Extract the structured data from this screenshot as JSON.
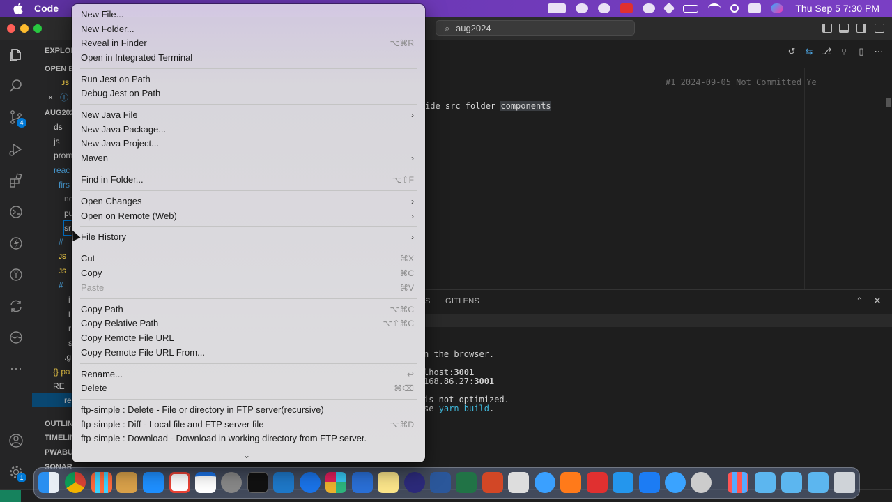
{
  "menubar": {
    "app_name": "Code",
    "clock": "Thu Sep 5  7:30 PM"
  },
  "titlebar": {
    "search_text": "aug2024"
  },
  "activity": {
    "scm_badge": "4",
    "account_badge": "1"
  },
  "sidebar": {
    "header": "EXPLORER",
    "open_editors": "OPEN E",
    "workspace": "AUG202",
    "items": [
      "ds",
      "js",
      "prom",
      "reac",
      "firs",
      "nc",
      "pu",
      "sr",
      "#",
      "JS",
      "JS",
      "#",
      "i",
      "l",
      "r",
      "s",
      ".g",
      "{} pa",
      "RE",
      "re"
    ],
    "outline": "OUTLIN",
    "timeline": "TIMELIN",
    "pwabu": "PWABU",
    "sonarlint": "SONARLINT ISSUE LOCATIONS"
  },
  "editor": {
    "blame": "#1 2024-09-05 Not Committed Ye",
    "code_prefix": "ide src folder ",
    "code_highlight": "components"
  },
  "panel": {
    "tab_partial": "S",
    "tab_gitlens": "GITLENS",
    "line1": "n the browser.",
    "line2_prefix": "lhost:",
    "line2_port": "3001",
    "line3_prefix": "168.86.27:",
    "line3_port": "3001",
    "line4": " is not optimized.",
    "line5_prefix": "se ",
    "line5_cmd": "yarn build",
    "line5_suffix": "."
  },
  "context_menu": {
    "items": [
      {
        "label": "New File...",
        "shortcut": ""
      },
      {
        "label": "New Folder...",
        "shortcut": ""
      },
      {
        "label": "Reveal in Finder",
        "shortcut": "⌥⌘R"
      },
      {
        "label": "Open in Integrated Terminal",
        "shortcut": ""
      },
      {
        "label": "Run Jest on Path",
        "shortcut": ""
      },
      {
        "label": "Debug Jest on Path",
        "shortcut": ""
      },
      {
        "label": "New Java File",
        "shortcut": ""
      },
      {
        "label": "New Java Package...",
        "shortcut": ""
      },
      {
        "label": "New Java Project...",
        "shortcut": ""
      },
      {
        "label": "Maven",
        "shortcut": ""
      },
      {
        "label": "Find in Folder...",
        "shortcut": "⌥⇧F"
      },
      {
        "label": "Open Changes",
        "shortcut": ""
      },
      {
        "label": "Open on Remote (Web)",
        "shortcut": ""
      },
      {
        "label": "File History",
        "shortcut": ""
      },
      {
        "label": "Cut",
        "shortcut": "⌘X"
      },
      {
        "label": "Copy",
        "shortcut": "⌘C"
      },
      {
        "label": "Paste",
        "shortcut": "⌘V"
      },
      {
        "label": "Copy Path",
        "shortcut": "⌥⌘C"
      },
      {
        "label": "Copy Relative Path",
        "shortcut": "⌥⇧⌘C"
      },
      {
        "label": "Copy Remote File URL",
        "shortcut": ""
      },
      {
        "label": "Copy Remote File URL From...",
        "shortcut": ""
      },
      {
        "label": "Rename...",
        "shortcut": "↩"
      },
      {
        "label": "Delete",
        "shortcut": "⌘⌫"
      },
      {
        "label": "ftp-simple : Delete - File or directory in FTP server(recursive)",
        "shortcut": ""
      },
      {
        "label": "ftp-simple : Diff - Local file and FTP server file",
        "shortcut": "⌥⌘D"
      },
      {
        "label": "ftp-simple : Download - Download in working directory from FTP server.",
        "shortcut": ""
      }
    ]
  },
  "colors": {
    "menubar": "#6b38b4",
    "accent": "#0078d4",
    "cyan_text": "#3fb6d8"
  }
}
